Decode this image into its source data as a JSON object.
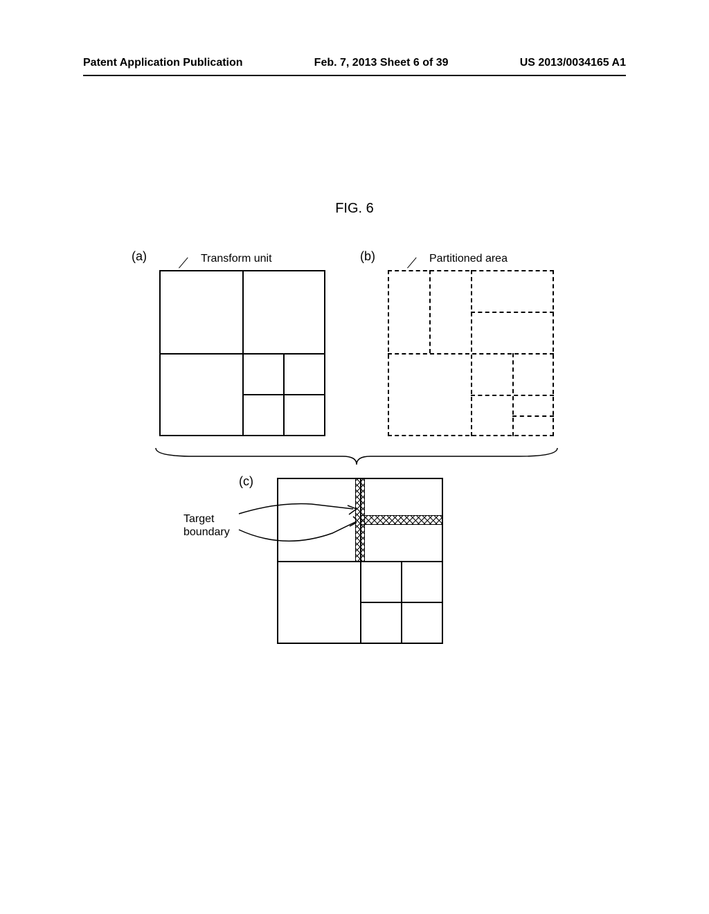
{
  "header": {
    "left": "Patent Application Publication",
    "center": "Feb. 7, 2013  Sheet 6 of 39",
    "right": "US 2013/0034165 A1"
  },
  "figure": {
    "title": "FIG. 6",
    "panel_a": {
      "label": "(a)",
      "annotation": "Transform unit"
    },
    "panel_b": {
      "label": "(b)",
      "annotation": "Partitioned area"
    },
    "panel_c": {
      "label": "(c)",
      "annotation": "Target\nboundary"
    }
  }
}
